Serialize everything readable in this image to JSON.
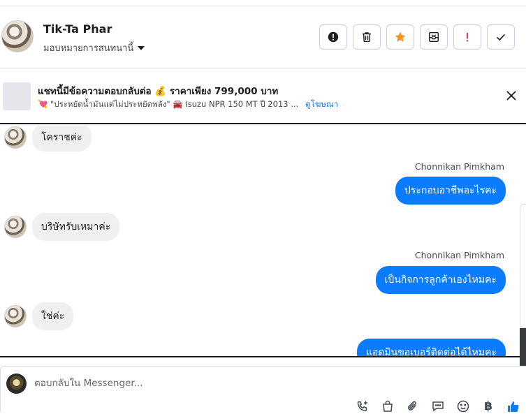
{
  "header": {
    "name": "Tik-Ta Phar",
    "assign_label": "มอบหมายการสนทนานี้"
  },
  "actions": [
    {
      "id": "report",
      "icon": "exclamation-circle-icon"
    },
    {
      "id": "delete",
      "icon": "trash-icon"
    },
    {
      "id": "star",
      "icon": "star-icon",
      "color": "#f7931e"
    },
    {
      "id": "archive",
      "icon": "archive-icon"
    },
    {
      "id": "spam",
      "icon": "exclamation-icon",
      "color": "#e41e3f"
    },
    {
      "id": "done",
      "icon": "check-icon"
    }
  ],
  "ad": {
    "title": "แชทนี้มีข้อความตอบกลับต่อ 💰 ราคาเพียง 799,000 บาท",
    "subtitle": "💘 \"ประหยัดน้ำมันแต่ไม่ประหยัดพลัง\" 🚘 Isuzu NPR 150 MT ปี 2013 ...",
    "link": "ดูโฆษณา"
  },
  "messages": [
    {
      "direction": "in",
      "text": "โคราชค่ะ"
    },
    {
      "direction": "out",
      "sender": "Chonnikan Pimkham",
      "text": "ประกอบอาชีพอะไรคะ"
    },
    {
      "direction": "in",
      "text": "บริษัทรับเหมาค่ะ"
    },
    {
      "direction": "out",
      "sender": "Chonnikan Pimkham",
      "text": "เป็นกิจการลูกค้าเองไหมคะ"
    },
    {
      "direction": "in",
      "text": "ใช่ค่ะ"
    },
    {
      "direction": "out",
      "text": "แอดมินขอเบอร์ติดต่อได้ไหมคะ"
    }
  ],
  "composer": {
    "placeholder": "ตอบกลับใน Messenger...",
    "baht_symbol": "฿"
  },
  "colors": {
    "accent": "#0a7cff",
    "star": "#f7931e",
    "danger": "#e41e3f"
  }
}
